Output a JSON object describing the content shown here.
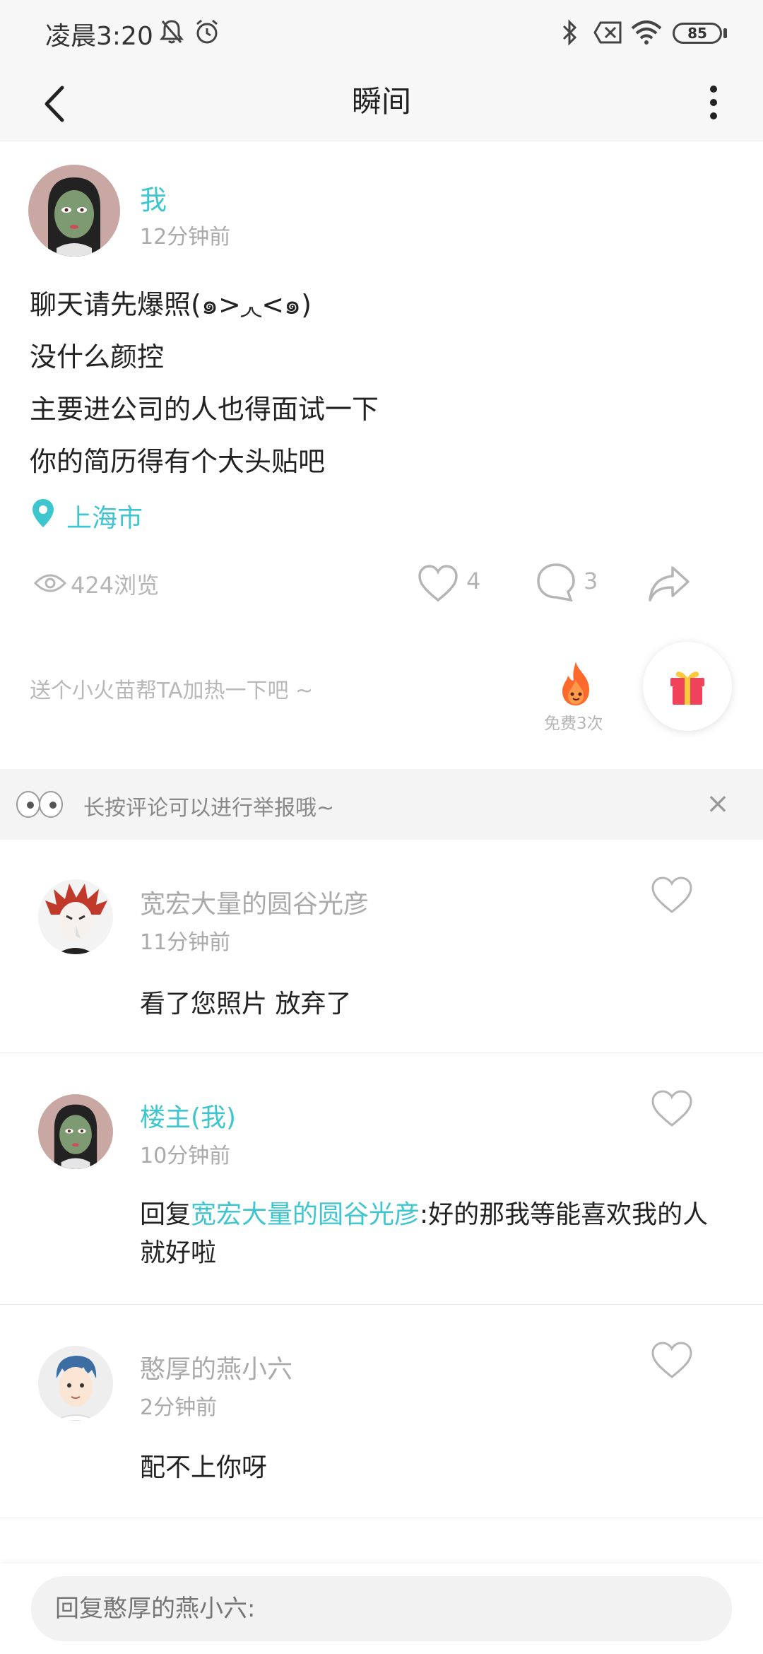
{
  "status_bar": {
    "time": "凌晨3:20",
    "battery": "85",
    "icons": [
      "bell-off-icon",
      "alarm-icon",
      "bluetooth-icon",
      "no-sim-icon",
      "wifi-icon",
      "battery-icon"
    ]
  },
  "header": {
    "title": "瞬间",
    "back_icon": "chevron-left-icon",
    "more_icon": "more-vertical-icon"
  },
  "post": {
    "author": "我",
    "time": "12分钟前",
    "lines": [
      "聊天请先爆照(๑>◞◟<๑)",
      "没什么颜控",
      "主要进公司的人也得面试一下",
      "你的简历得有个大头贴吧"
    ],
    "location": "上海市",
    "views": "424浏览",
    "likes": "4",
    "comments": "3",
    "boost_prompt": "送个小火苗帮TA加热一下吧 ~",
    "boost_free": "免费3次"
  },
  "report_bar": {
    "text": "长按评论可以进行举报哦~",
    "close": "×"
  },
  "comments": [
    {
      "name": "宽宏大量的圆谷光彦",
      "time": "11分钟前",
      "text": "看了您照片 放弃了",
      "is_author": false
    },
    {
      "name": "楼主(我)",
      "time": "10分钟前",
      "reply_prefix": "回复",
      "reply_to": "宽宏大量的圆谷光彦",
      "text": ":好的那我等能喜欢我的人就好啦",
      "is_author": true
    },
    {
      "name": "憨厚的燕小六",
      "time": "2分钟前",
      "text": "配不上你呀",
      "is_author": false
    }
  ],
  "reply": {
    "placeholder": "回复憨厚的燕小六:"
  },
  "colors": {
    "accent": "#3ec6cf",
    "muted": "#aaaaaa",
    "gift": "#f0425b"
  }
}
